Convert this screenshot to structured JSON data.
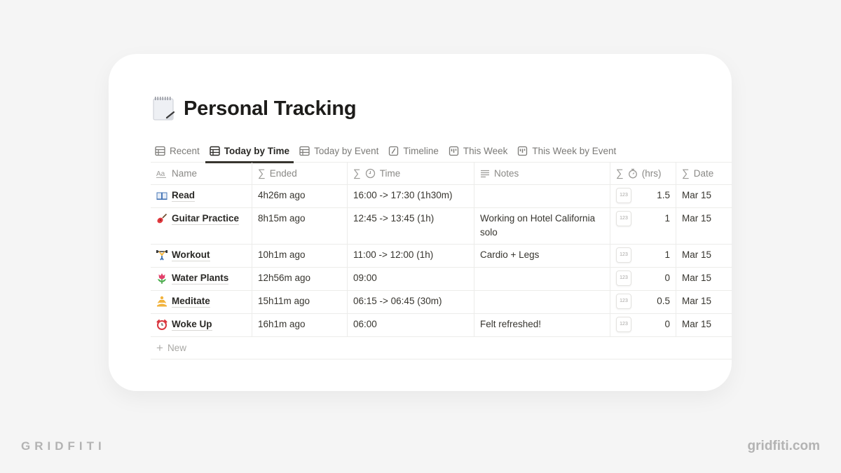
{
  "page": {
    "title": "Personal Tracking",
    "title_icon": "spiral-notepad-icon"
  },
  "tabs": [
    {
      "label": "Recent",
      "icon": "table-icon",
      "active": false
    },
    {
      "label": "Today by Time",
      "icon": "table-icon",
      "active": true
    },
    {
      "label": "Today by Event",
      "icon": "table-icon",
      "active": false
    },
    {
      "label": "Timeline",
      "icon": "timeline-icon",
      "active": false
    },
    {
      "label": "This Week",
      "icon": "board-icon",
      "active": false
    },
    {
      "label": "This Week by Event",
      "icon": "board-icon",
      "active": false
    }
  ],
  "columns": {
    "name": {
      "label": "Name",
      "icon": "text-aa-icon"
    },
    "ended": {
      "label": "Ended",
      "icon": "sigma-icon"
    },
    "time": {
      "label": "Time",
      "icon": "sigma-icon",
      "icon2": "clock-icon"
    },
    "notes": {
      "label": "Notes",
      "icon": "text-lines-icon"
    },
    "hrs": {
      "label": "(hrs)",
      "icon": "sigma-icon",
      "icon2": "stopwatch-icon"
    },
    "date": {
      "label": "Date",
      "icon": "sigma-icon"
    }
  },
  "rows": [
    {
      "emoji": "book-icon",
      "name": "Read",
      "ended": "4h26m ago",
      "time": "16:00 ->  17:30 (1h30m)",
      "notes": "",
      "badge": "123",
      "hrs": "1.5",
      "date": "Mar 15"
    },
    {
      "emoji": "guitar-icon",
      "name": "Guitar Practice",
      "ended": "8h15m ago",
      "time": "12:45 ->  13:45 (1h)",
      "notes": "Working on Hotel California solo",
      "badge": "123",
      "hrs": "1",
      "date": "Mar 15"
    },
    {
      "emoji": "weightlifter-icon",
      "name": "Workout",
      "ended": "10h1m ago",
      "time": "11:00 ->  12:00 (1h)",
      "notes": "Cardio + Legs",
      "badge": "123",
      "hrs": "1",
      "date": "Mar 15"
    },
    {
      "emoji": "tulip-icon",
      "name": "Water Plants",
      "ended": "12h56m ago",
      "time": "09:00",
      "notes": "",
      "badge": "123",
      "hrs": "0",
      "date": "Mar 15"
    },
    {
      "emoji": "meditation-icon",
      "name": "Meditate",
      "ended": "15h11m ago",
      "time": "06:15 ->  06:45 (30m)",
      "notes": "",
      "badge": "123",
      "hrs": "0.5",
      "date": "Mar 15"
    },
    {
      "emoji": "alarm-clock-icon",
      "name": "Woke Up",
      "ended": "16h1m ago",
      "time": "06:00",
      "notes": "Felt refreshed!",
      "badge": "123",
      "hrs": "0",
      "date": "Mar 15"
    }
  ],
  "new_row_label": "New",
  "branding": {
    "left": "GRIDFITI",
    "right": "gridfiti.com"
  }
}
